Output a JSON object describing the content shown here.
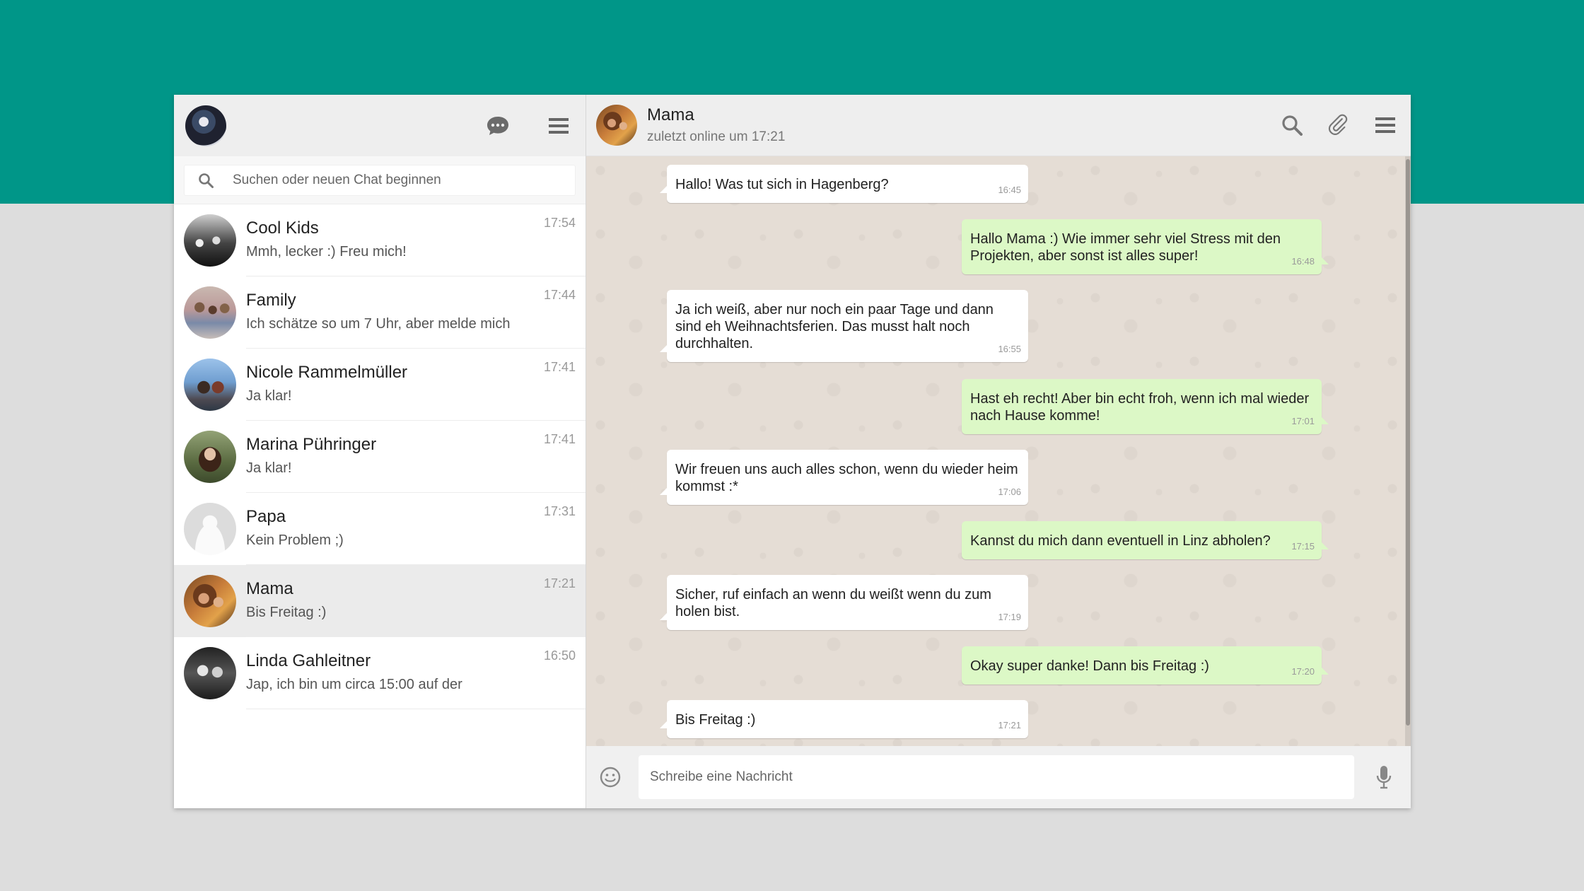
{
  "theme": {
    "accent": "#009688",
    "incoming_bubble": "#ffffff",
    "outgoing_bubble": "#dcf8c6",
    "chat_bg": "#e5ddd5"
  },
  "sidebar": {
    "icons": [
      "profile-avatar",
      "new-chat-icon",
      "menu-icon"
    ],
    "search": {
      "placeholder": "Suchen oder neuen Chat beginnen"
    },
    "chats": [
      {
        "name": "Cool Kids",
        "preview": "Mmh, lecker :) Freu mich!",
        "time": "17:54"
      },
      {
        "name": "Family",
        "preview": "Ich schätze so um 7 Uhr, aber melde mich",
        "time": "17:44"
      },
      {
        "name": "Nicole Rammelmüller",
        "preview": "Ja klar!",
        "time": "17:41"
      },
      {
        "name": "Marina Pühringer",
        "preview": "Ja klar!",
        "time": "17:41"
      },
      {
        "name": "Papa",
        "preview": "Kein Problem ;)",
        "time": "17:31"
      },
      {
        "name": "Mama",
        "preview": "Bis Freitag :)",
        "time": "17:21"
      },
      {
        "name": "Linda Gahleitner",
        "preview": "Jap, ich bin um circa 15:00 auf der",
        "time": "16:50"
      }
    ]
  },
  "conversation": {
    "contact_name": "Mama",
    "status": "zuletzt online um 17:21",
    "icons": [
      "search-icon",
      "attach-icon",
      "menu-icon"
    ],
    "messages": [
      {
        "dir": "in",
        "text": "Hallo! Was tut sich in Hagenberg?",
        "time": "16:45"
      },
      {
        "dir": "out",
        "text": "Hallo Mama :) Wie immer sehr viel Stress mit den Projekten, aber sonst ist alles super!",
        "time": "16:48"
      },
      {
        "dir": "in",
        "text": "Ja ich weiß, aber nur noch ein paar Tage und dann sind eh Weihnachtsferien. Das musst halt noch durchhalten.",
        "time": "16:55"
      },
      {
        "dir": "out",
        "text": "Hast eh recht! Aber bin echt froh, wenn ich mal wieder nach Hause komme!",
        "time": "17:01"
      },
      {
        "dir": "in",
        "text": "Wir freuen uns auch alles schon, wenn du wieder heim kommst :*",
        "time": "17:06"
      },
      {
        "dir": "out",
        "text": "Kannst du mich dann eventuell in Linz abholen?",
        "time": "17:15"
      },
      {
        "dir": "in",
        "text": "Sicher, ruf einfach an wenn du weißt wenn du zum holen bist.",
        "time": "17:19"
      },
      {
        "dir": "out",
        "text": "Okay super danke! Dann bis Freitag :)",
        "time": "17:20"
      },
      {
        "dir": "in",
        "text": "Bis Freitag :)",
        "time": "17:21"
      }
    ],
    "composer": {
      "placeholder": "Schreibe eine Nachricht"
    }
  }
}
